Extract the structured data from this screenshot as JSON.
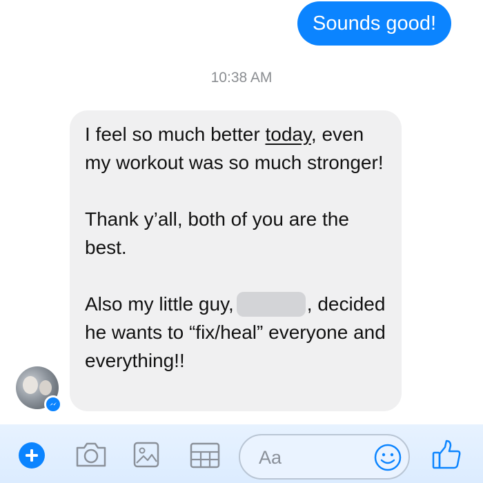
{
  "outgoing_message": {
    "text": "Sounds good!",
    "color": "#0b84ff"
  },
  "timestamp": "10:38 AM",
  "incoming_message": {
    "p1_before": "I feel so much better ",
    "p1_underlined": "today",
    "p1_after": ", even my workout was so much stronger!",
    "p2": "Thank y’all, both of you are the best.",
    "p3_before": "Also my little guy,",
    "p3_after": ", decided he wants to “fix/heal” everyone and everything!!",
    "bubble_color": "#f0f0f1"
  },
  "sender": {
    "avatar_icon": "avatar-photo",
    "badge_icon": "messenger-icon"
  },
  "composer": {
    "placeholder": "Aa",
    "icons": [
      "plus-icon",
      "camera-icon",
      "photo-icon",
      "gif-icon",
      "emoji-icon",
      "thumbs-up-icon"
    ],
    "accent": "#0b84ff"
  }
}
